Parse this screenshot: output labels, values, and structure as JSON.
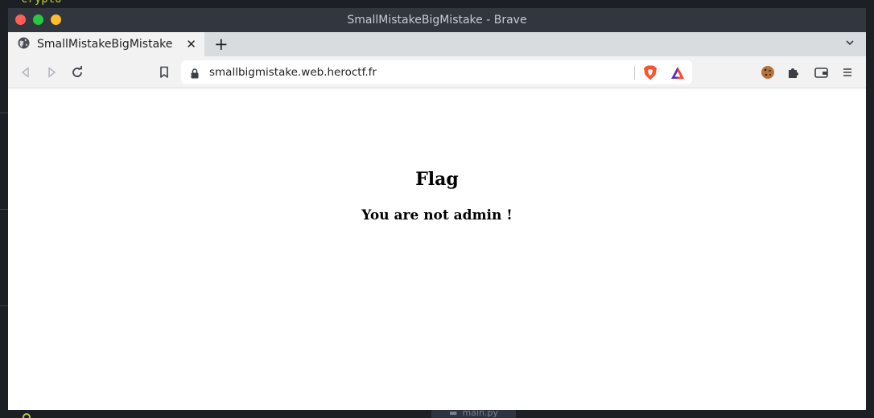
{
  "desktop": {
    "bg_text": "crypto",
    "bg_tab_label": "main.py"
  },
  "window": {
    "title": "SmallMistakeBigMistake - Brave"
  },
  "tabs": [
    {
      "title": "SmallMistakeBigMistake",
      "icon": "globe-icon",
      "active": true
    }
  ],
  "toolbar": {
    "url": "smallbigmistake.web.heroctf.fr",
    "icons": [
      "back-icon",
      "forward-icon",
      "reload-icon",
      "bookmark-icon",
      "lock-icon",
      "brave-shields-icon",
      "brave-rewards-icon",
      "cookie-extension-icon",
      "extensions-icon",
      "wallet-icon",
      "menu-icon"
    ]
  },
  "page": {
    "heading": "Flag",
    "message": "You are not admin !"
  },
  "colors": {
    "titlebar": "#31363f",
    "tabstrip": "#d9dcdf",
    "toolbar": "#f2f2f3",
    "close_red": "#fe5f57",
    "maximize_green": "#28c840",
    "minimize_yellow": "#febc2e",
    "brave_orange": "#fb542b"
  }
}
